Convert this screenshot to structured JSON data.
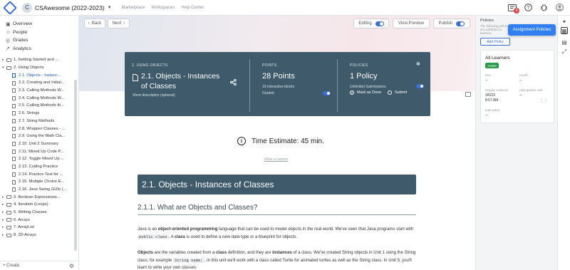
{
  "topnav": {
    "course_initial": "C",
    "course_title": "CSAwesome (2022-2023)",
    "links": [
      "Marketplace",
      "Workspaces",
      "Help Center"
    ],
    "notification_count": "3"
  },
  "sidebar": {
    "main_items": [
      {
        "icon": "overview-icon",
        "label": "Overview"
      },
      {
        "icon": "people-icon",
        "label": "People"
      },
      {
        "icon": "grades-icon",
        "label": "Grades"
      },
      {
        "icon": "analytics-icon",
        "label": "Analytics"
      }
    ],
    "tree": [
      {
        "label": "1. Getting Started and ...",
        "type": "folder",
        "level": 0,
        "expanded": false
      },
      {
        "label": "2. Using Objects",
        "type": "folder",
        "level": 0,
        "expanded": true
      },
      {
        "label": "2.1. Objects - Instanc...",
        "type": "page",
        "level": 1,
        "selected": true
      },
      {
        "label": "2.2. Creating and Initial...",
        "type": "page",
        "level": 1
      },
      {
        "label": "2.3. Calling Methods W...",
        "type": "page",
        "level": 1
      },
      {
        "label": "2.4. Calling Methods W...",
        "type": "page",
        "level": 1
      },
      {
        "label": "2.5. Calling Methods th...",
        "type": "page",
        "level": 1
      },
      {
        "label": "2.6. Strings",
        "type": "page",
        "level": 1
      },
      {
        "label": "2.7. String Methods",
        "type": "page",
        "level": 1
      },
      {
        "label": "2.8. Wrapper Classes - ...",
        "type": "page",
        "level": 1
      },
      {
        "label": "2.9. Using the Math Cla...",
        "type": "page",
        "level": 1
      },
      {
        "label": "2.10. Unit 2 Summary",
        "type": "page",
        "level": 1
      },
      {
        "label": "2.11. Mixed Up Code P...",
        "type": "page",
        "level": 1
      },
      {
        "label": "2.12. Toggle Mixed Up ...",
        "type": "page",
        "level": 1
      },
      {
        "label": "2.13. Coding Practice",
        "type": "page",
        "level": 1
      },
      {
        "label": "2.14. Practice Test for ...",
        "type": "page",
        "level": 1
      },
      {
        "label": "2.15. Multiple Choice E...",
        "type": "page",
        "level": 1
      },
      {
        "label": "2.16. Java Swing GUIs (...",
        "type": "page",
        "level": 1
      },
      {
        "label": "3. Boolean Expressions...",
        "type": "folder",
        "level": 0,
        "expanded": false
      },
      {
        "label": "4. Iteration (Loops)",
        "type": "folder",
        "level": 0,
        "expanded": false
      },
      {
        "label": "5. Writing Classes",
        "type": "folder",
        "level": 0,
        "expanded": false
      },
      {
        "label": "6. Arrays",
        "type": "folder",
        "level": 0,
        "expanded": false
      },
      {
        "label": "7. ArrayList",
        "type": "folder",
        "level": 0,
        "expanded": false
      },
      {
        "label": "8. 2D Arrays",
        "type": "folder",
        "level": 0,
        "expanded": false
      }
    ],
    "create_label": "+ Create"
  },
  "toolbar": {
    "back_label": "Back",
    "next_label": "Next",
    "editing_label": "Editing",
    "view_preview_label": "View Preview",
    "publish_label": "Publish"
  },
  "info_card": {
    "section_header": "2. USING OBJECTS",
    "page_title": "2.1. Objects - Instances of Classes",
    "description_placeholder": "Short description (optional)",
    "points_header": "POINTS",
    "points_value": "28 Points",
    "interactive_blocks": "19 interactive blocks",
    "graded_label": "Graded",
    "policies_header": "POLICIES",
    "policies_value": "1 Policy",
    "unlimited_label": "Unlimited Submissions",
    "mark_done_label": "Mark as Done",
    "submit_label": "Submit"
  },
  "content": {
    "time_estimate": "Time Estimate: 45 min.",
    "write_caption": "Write a caption",
    "heading": "2.1. Objects - Instances of Classes",
    "subheading": "2.1.1. What are Objects and Classes?",
    "p1_a": "Java is an ",
    "p1_b": "object-oriented programming",
    "p1_c": " language that can be used to model objects in the real world. We've seen that Java programs start with ",
    "p1_code": "public class",
    "p1_d": ". A ",
    "p1_e": "class",
    "p1_f": " is used to define a new data type or a blueprint for objects.",
    "p2_a": "Objects",
    "p2_b": " are the variables created from a ",
    "p2_c": "class",
    "p2_d": " definition, and they are ",
    "p2_e": "instances",
    "p2_f": " of a class. We've created String objects in Unit 1 using the String class, for example ",
    "p2_code": "String name;",
    "p2_g": ". In this unit we'll work with a class called Turtle for animated turtles as well as the String class. In Unit 5, you'll learn to write your own classes."
  },
  "right_panel": {
    "title": "Policies",
    "subtitle": "The following policies are published to learners",
    "add_policy_label": "Add Policy",
    "assign_label": "Assignment Policies",
    "learners_title": "All Learners",
    "status": "Active",
    "due_label": "Due",
    "due_value": "--",
    "cutoff_label": "Cutoff",
    "cutoff_value": "--",
    "display_solutions_label": "Display solutions",
    "display_solutions_value": "3/6/23\n8:57 AM",
    "hide_grades_label": "Hide grades until",
    "hide_grades_value": "--",
    "late_policy_label": "Late policy",
    "late_policy_value": "--"
  },
  "colors": {
    "accent": "#3b6fd6",
    "card_bg": "#3e5a6b",
    "active_green": "#2a9d4c",
    "assign_blue": "#2f7ff0"
  }
}
